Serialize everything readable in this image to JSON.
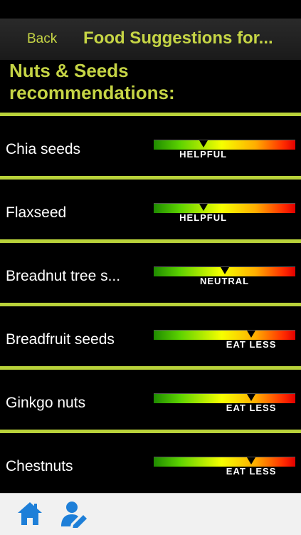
{
  "nav": {
    "back_label": "Back",
    "title": "Food Suggestions for..."
  },
  "section_heading": "Nuts & Seeds recommendations:",
  "items": [
    {
      "name": "Chia seeds",
      "rating": "HELPFUL",
      "level": 0.35
    },
    {
      "name": "Flaxseed",
      "rating": "HELPFUL",
      "level": 0.35
    },
    {
      "name": "Breadnut tree s...",
      "rating": "NEUTRAL",
      "level": 0.5
    },
    {
      "name": "Breadfruit seeds",
      "rating": "EAT LESS",
      "level": 0.69
    },
    {
      "name": "Ginkgo nuts",
      "rating": "EAT LESS",
      "level": 0.69
    },
    {
      "name": "Chestnuts",
      "rating": "EAT LESS",
      "level": 0.69
    }
  ],
  "tabbar": {
    "icons": [
      "home-icon",
      "edit-user-icon"
    ],
    "color": "#1e7fd8"
  },
  "colors": {
    "accent": "#c6d545",
    "divider": "#b9d23a"
  }
}
